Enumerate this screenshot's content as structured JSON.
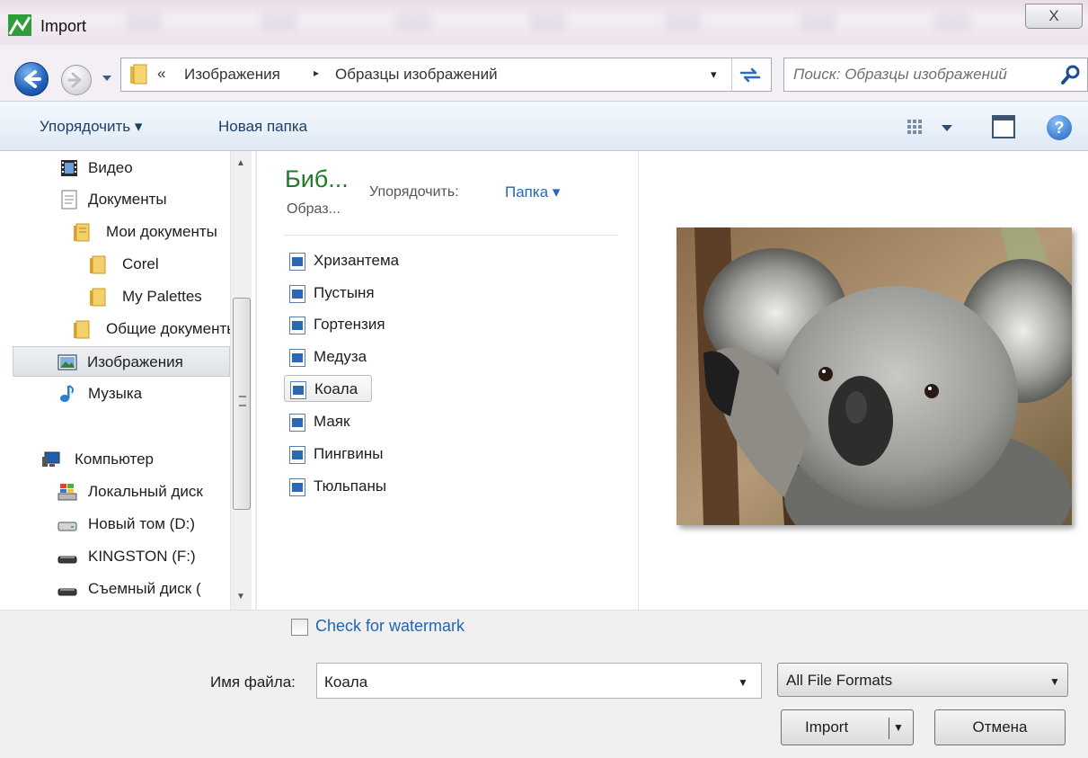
{
  "window": {
    "title": "Import",
    "close_label": "X"
  },
  "address_bar": {
    "overflow_chevron": "«",
    "crumbs": [
      "Изображения",
      "Образцы изображений"
    ],
    "separator": "▸",
    "dropdown_glyph": "▾",
    "search_placeholder": "Поиск: Образцы изображений"
  },
  "toolbar": {
    "organize_label": "Упорядочить ▾",
    "new_folder_label": "Новая папка",
    "help_label": "?"
  },
  "nav": {
    "items": [
      {
        "label": "Видео",
        "icon": "video-icon"
      },
      {
        "label": "Документы",
        "icon": "documents-icon"
      },
      {
        "label": "Мои документы",
        "icon": "folder-icon"
      },
      {
        "label": "Corel",
        "icon": "folder-icon"
      },
      {
        "label": "My Palettes",
        "icon": "folder-icon"
      },
      {
        "label": "Общие документы",
        "icon": "folder-icon"
      },
      {
        "label": "Изображения",
        "icon": "pictures-icon",
        "selected": true
      },
      {
        "label": "Музыка",
        "icon": "music-icon"
      },
      {
        "label": "Компьютер",
        "icon": "computer-icon"
      },
      {
        "label": "Локальный диск",
        "icon": "windows-drive-icon"
      },
      {
        "label": "Новый том (D:)",
        "icon": "drive-icon"
      },
      {
        "label": "KINGSTON (F:)",
        "icon": "removable-drive-icon"
      },
      {
        "label": "Съемный диск (",
        "icon": "removable-drive-icon"
      }
    ]
  },
  "library": {
    "title": "Биб...",
    "subtitle": "Образ...",
    "arrange_label": "Упорядочить:",
    "arrange_value": "Папка ▾"
  },
  "files": [
    {
      "name": "Хризантема"
    },
    {
      "name": "Пустыня"
    },
    {
      "name": "Гортензия"
    },
    {
      "name": "Медуза"
    },
    {
      "name": "Коала",
      "selected": true
    },
    {
      "name": "Маяк"
    },
    {
      "name": "Пингвины"
    },
    {
      "name": "Тюльпаны"
    }
  ],
  "preview": {
    "subject": "koala photo"
  },
  "options": {
    "watermark_label": "Check for watermark",
    "watermark_checked": false
  },
  "filename": {
    "label": "Имя файла:",
    "value": "Коала"
  },
  "format": {
    "selected": "All File Formats"
  },
  "buttons": {
    "import_label": "Import",
    "cancel_label": "Отмена"
  },
  "colors": {
    "library_title": "#1f7a2a",
    "link_blue": "#2767b6",
    "toolbar_text": "#1e3f66"
  }
}
